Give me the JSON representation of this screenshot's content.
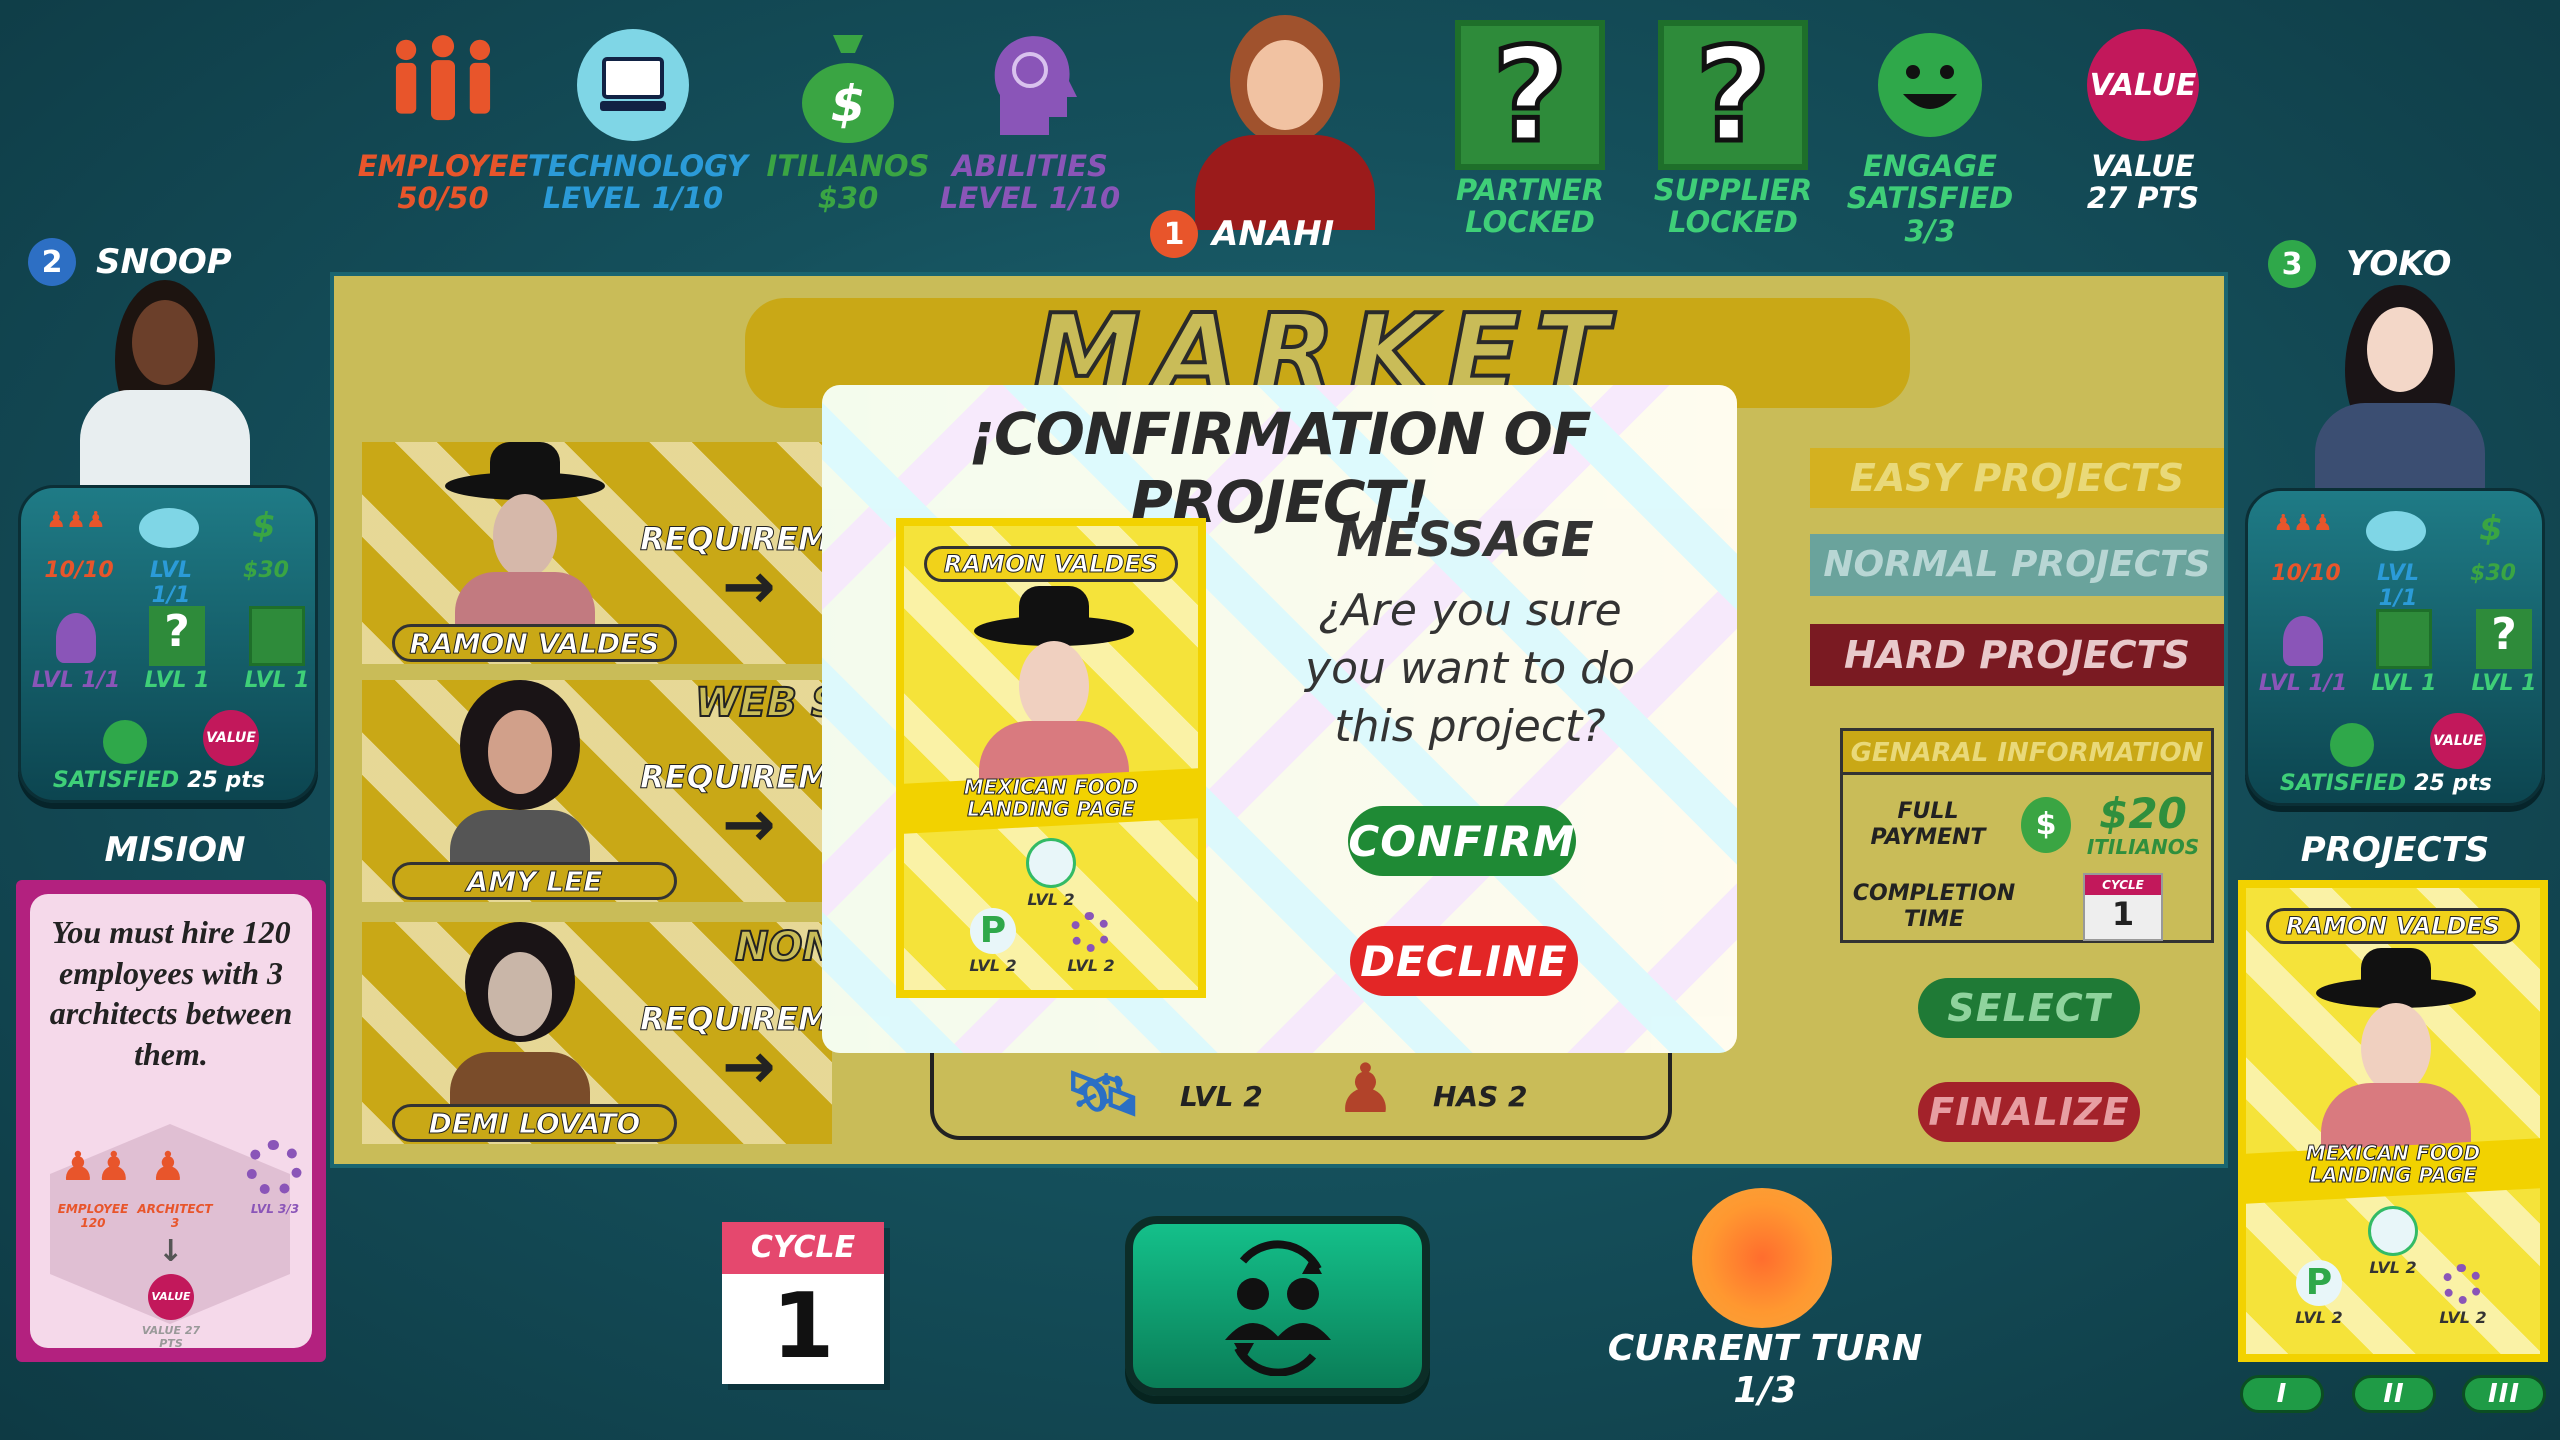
{
  "top_stats": {
    "employee": {
      "label": "EMPLOYEE",
      "value": "50/50",
      "color": "#e8552b"
    },
    "technology": {
      "label": "TECHNOLOGY",
      "value": "LEVEL  1/10",
      "color": "#2b9bd8"
    },
    "itilianos": {
      "label": "ITILIANOS",
      "value": "$30",
      "color": "#3aa543"
    },
    "abilities": {
      "label": "ABILITIES",
      "value": "LEVEL  1/10",
      "color": "#8a55b8"
    },
    "current_player": {
      "number": "1",
      "name": "ANAHI"
    },
    "partner": {
      "label": "PARTNER",
      "value": "LOCKED"
    },
    "supplier": {
      "label": "SUPPLIER",
      "value": "LOCKED"
    },
    "engage": {
      "label": "ENGAGE",
      "status": "SATISFIED",
      "value": "3/3"
    },
    "value": {
      "badge": "VALUE",
      "label": "VALUE",
      "pts": "27 PTS"
    }
  },
  "left_player": {
    "number": "2",
    "name": "SNOOP",
    "employees": "10/10",
    "tech": "LVL 1/1",
    "money": "$30",
    "abilities": "LVL 1/1",
    "slot2": "LVL 1",
    "slot3": "LVL 1",
    "status": "SATISFIED",
    "value_badge": "VALUE",
    "pts": "25 pts"
  },
  "right_player": {
    "number": "3",
    "name": "YOKO",
    "employees": "10/10",
    "tech": "LVL 1/1",
    "money": "$30",
    "abilities": "LVL 1/1",
    "slot2": "LVL 1",
    "slot3": "LVL 1",
    "status": "SATISFIED",
    "value_badge": "VALUE",
    "pts": "25 pts"
  },
  "mision": {
    "title": "MISION",
    "text": "You must hire 120 employees with 3 architects between them.",
    "employee_label": "EMPLOYEE",
    "employee_value": "120",
    "architect_label": "ARCHITECT",
    "architect_value": "3",
    "level_label": "LVL 3/3",
    "value_badge": "VALUE",
    "value_pts": "VALUE 27 PTS"
  },
  "market": {
    "title": "MARKET DEMAND",
    "cards": [
      {
        "name": "RAMON VALDES",
        "req": "REQUIREM",
        "header": ""
      },
      {
        "name": "AMY LEE",
        "req": "REQUIREM",
        "header": "WEB S"
      },
      {
        "name": "DEMI LOVATO",
        "req": "REQUIREM",
        "header": "NON"
      }
    ],
    "bottom_lvl": "LVL 2",
    "bottom_has": "HAS 2"
  },
  "filters": {
    "easy": "EASY PROJECTS",
    "normal": "NORMAL PROJECTS",
    "hard": "HARD PROJECTS"
  },
  "general_info": {
    "title": "GENARAL INFORMATION",
    "payment_label": "FULL PAYMENT",
    "payment_value": "$20",
    "currency": "ITILIANOS",
    "time_label": "COMPLETION TIME",
    "cycle_badge": "CYCLE",
    "time_value": "1"
  },
  "actions": {
    "select": "SELECT",
    "finalize": "FINALIZE"
  },
  "projects": {
    "title": "PROJECTS",
    "card_name": "RAMON VALDES",
    "card_subtitle": "MEXICAN FOOD LANDING PAGE",
    "tech_lvl": "LVL 2",
    "p_lvl": "LVL 2",
    "gear_lvl": "LVL 2",
    "pages": [
      "I",
      "II",
      "III"
    ]
  },
  "cycle": {
    "label": "CYCLE",
    "value": "1"
  },
  "turn": {
    "label": "CURRENT TURN",
    "value": "1/3"
  },
  "modal": {
    "title": "¡CONFIRMATION OF PROJECT!",
    "card_name": "RAMON VALDES",
    "card_subtitle": "MEXICAN FOOD LANDING PAGE",
    "tech_lvl": "LVL 2",
    "p_lvl": "LVL 2",
    "gear_lvl": "LVL 2",
    "message_title": "MESSAGE",
    "message": "¿Are you sure you want to do this project?",
    "confirm": "CONFIRM",
    "decline": "DECLINE"
  }
}
